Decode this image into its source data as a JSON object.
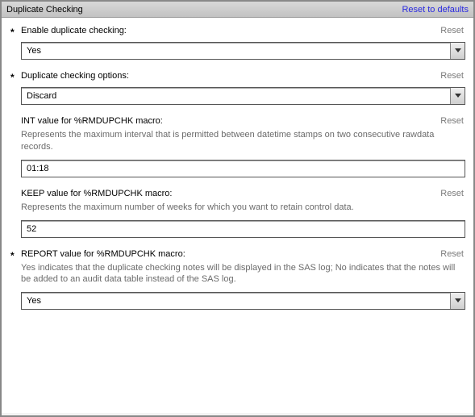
{
  "header": {
    "title": "Duplicate Checking",
    "reset_defaults": "Reset to defaults"
  },
  "common": {
    "reset": "Reset",
    "asterisk": "*"
  },
  "fields": {
    "enable": {
      "label": "Enable duplicate checking:",
      "value": "Yes"
    },
    "options": {
      "label": "Duplicate checking options:",
      "value": "Discard"
    },
    "int": {
      "label": "INT value for %RMDUPCHK macro:",
      "desc": "Represents the maximum interval that is permitted between datetime stamps on two consecutive rawdata records.",
      "value": "01:18"
    },
    "keep": {
      "label": "KEEP value for %RMDUPCHK macro:",
      "desc": "Represents the maximum number of weeks for which you want to retain control data.",
      "value": "52"
    },
    "report": {
      "label": "REPORT value for %RMDUPCHK macro:",
      "desc": "Yes indicates that the duplicate checking notes will be displayed in the SAS log; No indicates that the notes will be added to an audit data table instead of the SAS log.",
      "value": "Yes"
    }
  }
}
